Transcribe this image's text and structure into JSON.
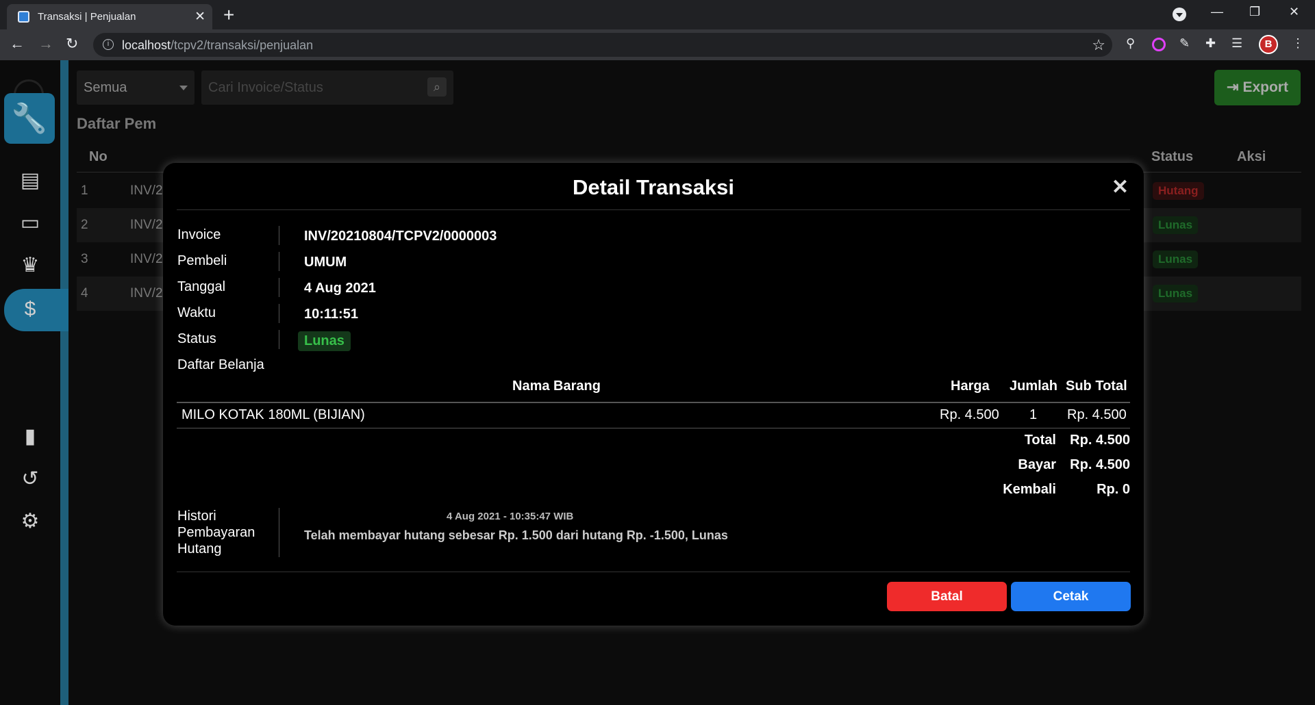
{
  "browser": {
    "tab_title": "Transaksi | Penjualan",
    "url_host": "localhost",
    "url_path": "/tcpv2/transaksi/penjualan",
    "avatar_letter": "B"
  },
  "page": {
    "filter_value": "Semua",
    "search_placeholder": "Cari Invoice/Status",
    "export_label": "Export",
    "list_title": "Daftar Pem",
    "columns": {
      "no": "No",
      "status": "Status",
      "aksi": "Aksi"
    },
    "rows": [
      {
        "no": "1",
        "invoice": "INV/2",
        "status": "Hutang"
      },
      {
        "no": "2",
        "invoice": "INV/2",
        "status": "Lunas"
      },
      {
        "no": "3",
        "invoice": "INV/2",
        "status": "Lunas"
      },
      {
        "no": "4",
        "invoice": "INV/2",
        "status": "Lunas"
      }
    ]
  },
  "modal": {
    "title": "Detail Transaksi",
    "close": "✕",
    "fields": {
      "invoice_label": "Invoice",
      "invoice_value": "INV/20210804/TCPV2/0000003",
      "pembeli_label": "Pembeli",
      "pembeli_value": "UMUM",
      "tanggal_label": "Tanggal",
      "tanggal_value": "4 Aug 2021",
      "waktu_label": "Waktu",
      "waktu_value": "10:11:51",
      "status_label": "Status",
      "status_value": "Lunas",
      "daftar_label": "Daftar Belanja"
    },
    "items_table": {
      "headers": {
        "nama": "Nama Barang",
        "harga": "Harga",
        "jumlah": "Jumlah",
        "subtotal": "Sub Total"
      },
      "rows": [
        {
          "nama": "MILO KOTAK 180ML (BIJIAN)",
          "harga": "Rp. 4.500",
          "jumlah": "1",
          "subtotal": "Rp. 4.500"
        }
      ]
    },
    "totals": {
      "total_label": "Total",
      "total_value": "Rp. 4.500",
      "bayar_label": "Bayar",
      "bayar_value": "Rp. 4.500",
      "kembali_label": "Kembali",
      "kembali_value": "Rp. 0"
    },
    "history": {
      "label_line1": "Histori",
      "label_line2": "Pembayaran",
      "label_line3": "Hutang",
      "timestamp": "4 Aug 2021 - 10:35:47 WIB",
      "text": "Telah membayar hutang sebesar Rp. 1.500 dari hutang Rp. -1.500, Lunas"
    },
    "buttons": {
      "batal": "Batal",
      "cetak": "Cetak"
    }
  },
  "colors": {
    "accent": "#1c6e93",
    "danger": "#ef2b2b",
    "primary": "#1f78f0",
    "success": "#37c04a",
    "export": "#1c5d1c"
  }
}
